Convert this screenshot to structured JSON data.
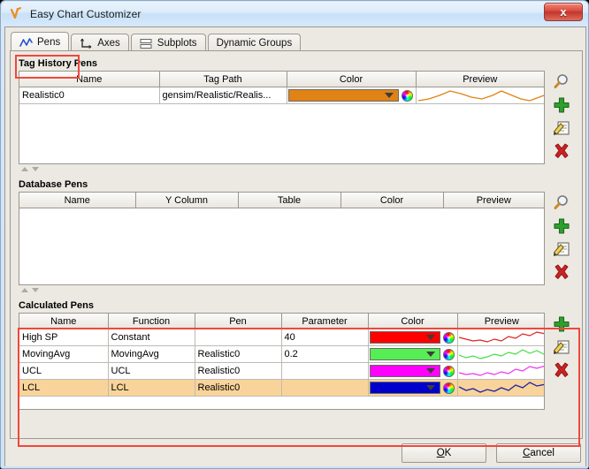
{
  "window": {
    "title": "Easy Chart Customizer",
    "icon": "chart-pen-icon",
    "close_label": "x"
  },
  "tabs": [
    {
      "label": "Pens",
      "icon": "line-chart-icon",
      "selected": true,
      "highlighted": true
    },
    {
      "label": "Axes",
      "icon": "axes-icon",
      "selected": false,
      "highlighted": false
    },
    {
      "label": "Subplots",
      "icon": "subplots-icon",
      "selected": false,
      "highlighted": false
    },
    {
      "label": "Dynamic Groups",
      "icon": "",
      "selected": false,
      "highlighted": false
    }
  ],
  "sections": {
    "tag_history": {
      "title": "Tag History Pens",
      "columns": [
        "Name",
        "Tag Path",
        "Color",
        "Preview"
      ],
      "rows": [
        {
          "name": "Realistic0",
          "tag_path": "gensim/Realistic/Realis...",
          "color": "#e08214",
          "preview_color": "#e08214",
          "selected": false
        }
      ],
      "buttons": [
        {
          "icon": "magnifier-icon",
          "name": "browse-tag-button"
        },
        {
          "icon": "plus-icon",
          "name": "add-pen-button"
        },
        {
          "icon": "edit-icon",
          "name": "edit-pen-button"
        },
        {
          "icon": "delete-icon",
          "name": "delete-pen-button"
        }
      ]
    },
    "database": {
      "title": "Database Pens",
      "columns": [
        "Name",
        "Y Column",
        "Table",
        "Color",
        "Preview"
      ],
      "rows": [],
      "buttons": [
        {
          "icon": "magnifier-icon",
          "name": "browse-db-button"
        },
        {
          "icon": "plus-icon",
          "name": "add-db-pen-button"
        },
        {
          "icon": "edit-icon",
          "name": "edit-db-pen-button"
        },
        {
          "icon": "delete-icon",
          "name": "delete-db-pen-button"
        }
      ]
    },
    "calculated": {
      "title": "Calculated Pens",
      "highlighted": true,
      "columns": [
        "Name",
        "Function",
        "Pen",
        "Parameter",
        "Color",
        "Preview"
      ],
      "rows": [
        {
          "name": "High SP",
          "function": "Constant",
          "pen": "",
          "parameter": "40",
          "color": "#ff0000",
          "preview_color": "#dd2222",
          "selected": false
        },
        {
          "name": "MovingAvg",
          "function": "MovingAvg",
          "pen": "Realistic0",
          "parameter": "0.2",
          "color": "#55ee55",
          "preview_color": "#44dd44",
          "selected": false
        },
        {
          "name": "UCL",
          "function": "UCL",
          "pen": "Realistic0",
          "parameter": "",
          "color": "#ff00ff",
          "preview_color": "#ee33ee",
          "selected": false
        },
        {
          "name": "LCL",
          "function": "LCL",
          "pen": "Realistic0",
          "parameter": "",
          "color": "#0000cc",
          "preview_color": "#2222aa",
          "selected": true
        }
      ],
      "buttons": [
        {
          "icon": "plus-icon",
          "name": "add-calc-pen-button"
        },
        {
          "icon": "edit-icon",
          "name": "edit-calc-pen-button"
        },
        {
          "icon": "delete-icon",
          "name": "delete-calc-pen-button"
        }
      ]
    }
  },
  "footer": {
    "ok": "OK",
    "ok_mnemonic": "O",
    "cancel": "Cancel",
    "cancel_mnemonic": "C"
  },
  "colors": {
    "selection": "#f9d49a",
    "highlight_outline": "#f0483c",
    "panel": "#ece9e3",
    "titlebar": "#d6e7f8"
  }
}
